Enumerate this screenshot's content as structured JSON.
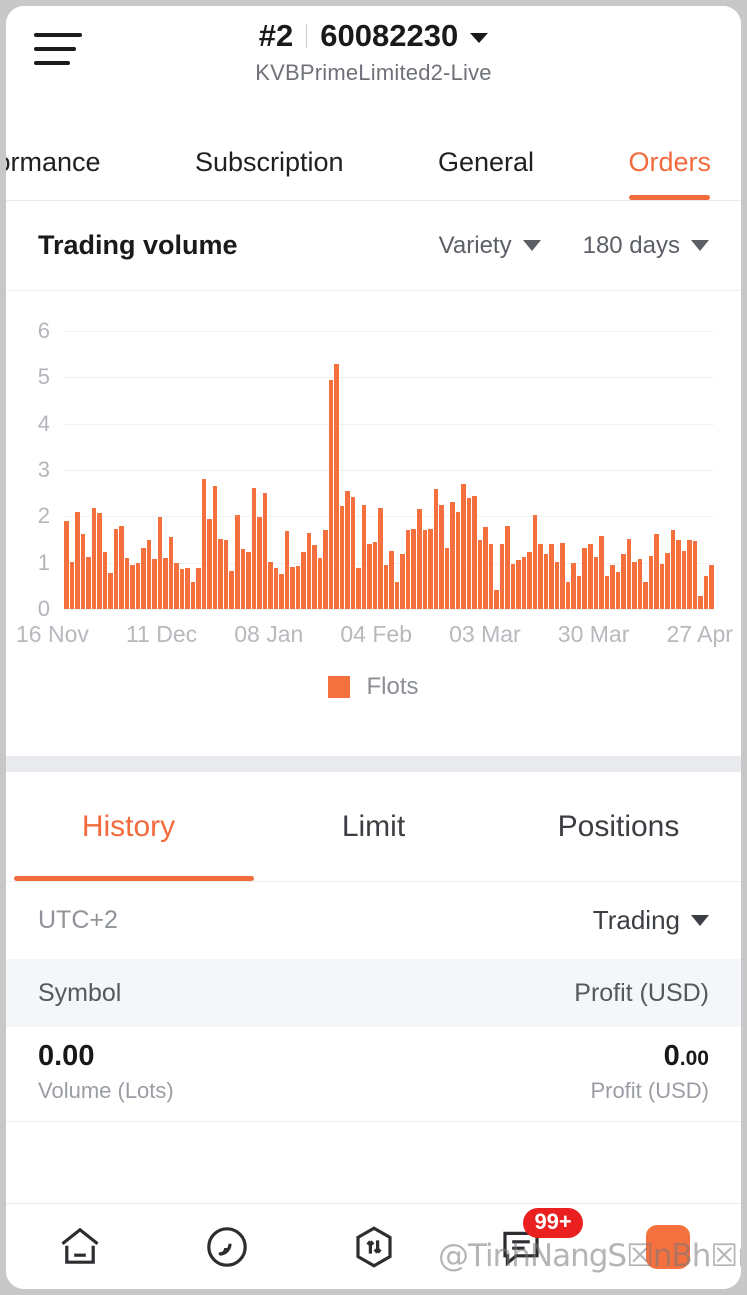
{
  "header": {
    "menu_icon": "hamburger-icon",
    "account_index": "#2",
    "account_number": "60082230",
    "dropdown_icon": "chevron-down-icon",
    "server": "KVBPrimeLimited2-Live"
  },
  "top_tabs": [
    {
      "label": "formance",
      "active": false
    },
    {
      "label": "Subscription",
      "active": false
    },
    {
      "label": "General",
      "active": false
    },
    {
      "label": "Orders",
      "active": true
    }
  ],
  "chart_card": {
    "title": "Trading volume",
    "variety_label": "Variety",
    "period_label": "180 days",
    "dropdown_icon": "caret-down-icon"
  },
  "chart_data": {
    "type": "bar",
    "title": "Trading volume",
    "xlabel": "",
    "ylabel": "",
    "ylim": [
      0,
      6
    ],
    "yticks": [
      0,
      1,
      2,
      3,
      4,
      5,
      6
    ],
    "grid": true,
    "legend_position": "bottom",
    "series": [
      {
        "name": "Flots",
        "color": "#f4703f",
        "values": [
          1.9,
          1.02,
          2.1,
          1.62,
          1.12,
          2.18,
          2.07,
          1.24,
          0.78,
          1.72,
          1.8,
          1.1,
          0.95,
          1.0,
          1.32,
          1.5,
          1.08,
          1.98,
          1.1,
          1.55,
          1.0,
          0.86,
          0.88,
          0.58,
          0.88,
          2.8,
          1.95,
          2.65,
          1.52,
          1.5,
          0.82,
          2.02,
          1.3,
          1.24,
          2.62,
          1.98,
          2.5,
          1.02,
          0.88,
          0.76,
          1.68,
          0.9,
          0.92,
          1.22,
          1.64,
          1.38,
          1.1,
          1.7,
          4.95,
          5.28,
          2.22,
          2.55,
          2.42,
          0.88,
          2.25,
          1.4,
          1.45,
          2.18,
          0.96,
          1.26,
          0.58,
          1.18,
          1.7,
          1.72,
          2.15,
          1.7,
          1.72,
          2.58,
          2.25,
          1.32,
          2.32,
          2.1,
          2.7,
          2.4,
          2.44,
          1.48,
          1.78,
          1.4,
          0.42,
          1.4,
          1.8,
          0.98,
          1.06,
          1.12,
          1.22,
          2.02,
          1.4,
          1.18,
          1.4,
          1.02,
          1.42,
          0.58,
          1.0,
          0.72,
          1.32,
          1.4,
          1.12,
          1.58,
          0.72,
          0.96,
          0.8,
          1.18,
          1.52,
          1.02,
          1.08,
          0.58,
          1.15,
          1.62,
          0.98,
          1.2,
          1.7,
          1.48,
          1.25,
          1.48,
          1.47,
          0.28,
          0.72,
          0.94
        ]
      }
    ],
    "xtick_labels": [
      "16 Nov",
      "11 Dec",
      "08 Jan",
      "04 Feb",
      "03 Mar",
      "30 Mar",
      "27 Apr"
    ],
    "legend": [
      {
        "label": "Flots",
        "color": "#f4703f"
      }
    ]
  },
  "sub_tabs": [
    {
      "label": "History",
      "active": true
    },
    {
      "label": "Limit",
      "active": false
    },
    {
      "label": "Positions",
      "active": false
    }
  ],
  "filter_row": {
    "timezone": "UTC+2",
    "filter_label": "Trading",
    "dropdown_icon": "caret-down-icon"
  },
  "table": {
    "columns": [
      "Symbol",
      "Profit (USD)"
    ],
    "rows": [
      {
        "volume_value": "0.00",
        "volume_label": "Volume (Lots)",
        "profit_int": "0",
        "profit_dec": ".00",
        "profit_label": "Profit (USD)"
      }
    ]
  },
  "bottom_nav": {
    "items": [
      {
        "icon": "home-icon",
        "badge": null
      },
      {
        "icon": "signal-rss-icon",
        "badge": null
      },
      {
        "icon": "hexagon-transfer-icon",
        "badge": null
      },
      {
        "icon": "chat-message-icon",
        "badge": "99+"
      },
      {
        "icon": "app-grid-icon",
        "badge": null
      }
    ]
  },
  "watermark": {
    "text": "@TinhNangS☒nBh☒m"
  },
  "colors": {
    "accent": "#f26b3d",
    "bar": "#f4703f",
    "badge": "#ea2020",
    "text_primary": "#1a1a1a",
    "text_muted": "#8f9399"
  }
}
